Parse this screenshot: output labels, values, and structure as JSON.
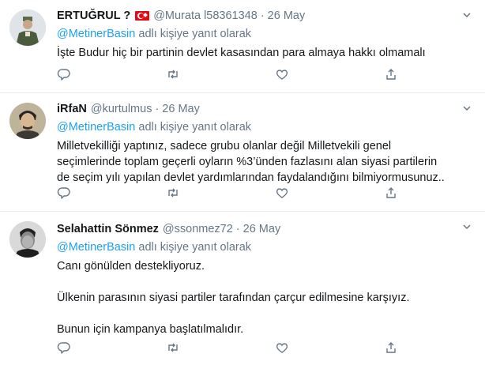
{
  "tweets": [
    {
      "name": "ERTUĞRUL ?",
      "has_flag": true,
      "handle": "@Murata l58361348",
      "time": "26 May",
      "reply_prefix": "@MetinerBasin",
      "reply_suffix": "adlı kişiye yanıt olarak",
      "lines": [
        "İşte Budur hiç bir partinin devlet kasasından para almaya hakkı olmamalı"
      ]
    },
    {
      "name": "iRfaN",
      "handle": "@kurtulmus",
      "time": "26 May",
      "reply_prefix": "@MetinerBasin",
      "reply_suffix": "adlı kişiye yanıt olarak",
      "lines": [
        "Milletvekilliği yaptınız, sadece grubu olanlar değil Milletvekili genel",
        "seçimlerinde toplam geçerli oyların %3’ünden fazlasını alan siyasi partilerin",
        "de seçim yılı yapılan devlet yardımlarından faydalandığını bilmiyormusunuz.."
      ]
    },
    {
      "name": "Selahattin Sönmez",
      "handle": "@ssonmez72",
      "time": "26 May",
      "reply_prefix": "@MetinerBasin",
      "reply_suffix": "adlı kişiye yanıt olarak",
      "paragraphs": [
        "Canı gönülden destekliyoruz.",
        "Ülkenin parasının siyasi partiler tarafından çarçur edilmesine karşıyız.",
        "Bunun için kampanya başlatılmalıdır."
      ]
    }
  ],
  "separator": "·",
  "icons": {
    "reply": "reply-icon",
    "retweet": "retweet-icon",
    "like": "heart-icon",
    "share": "share-icon",
    "menu": "chevron-down-icon"
  },
  "colors": {
    "link": "#1da1f2",
    "muted": "#657786",
    "text": "#14171a",
    "border": "#e6ecf0"
  }
}
